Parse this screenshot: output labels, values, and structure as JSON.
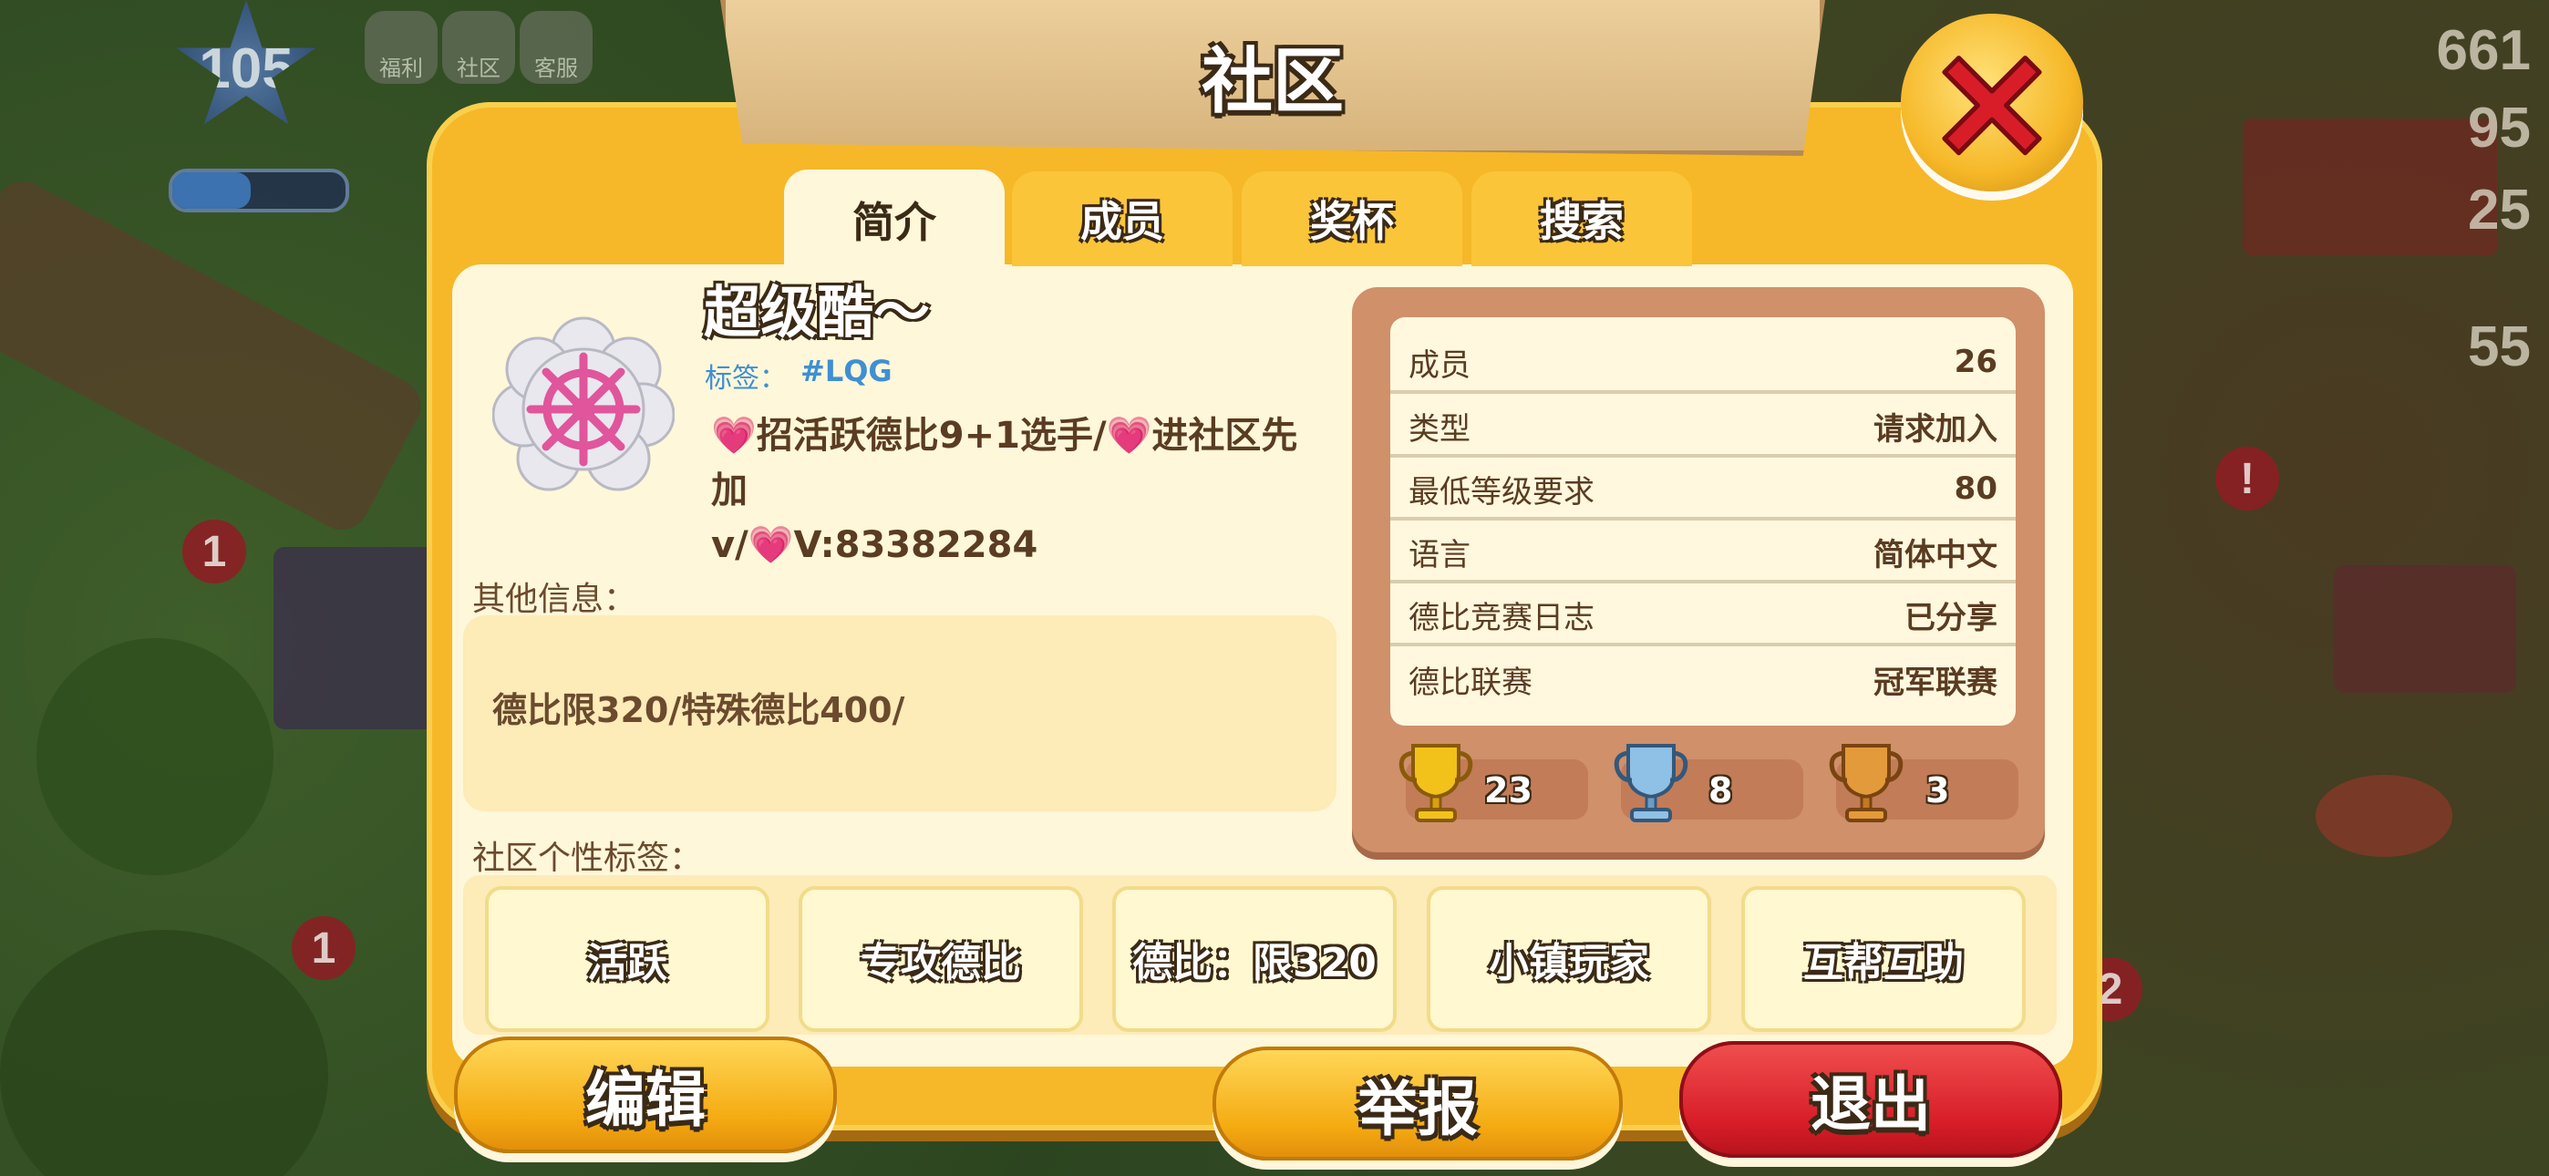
{
  "hud": {
    "level": "105",
    "icons": [
      "福利",
      "社区",
      "客服"
    ],
    "right_numbers": [
      "661",
      "95",
      "25",
      "55"
    ],
    "side_badges": [
      "1",
      "1",
      "!",
      "2"
    ]
  },
  "dialog": {
    "title": "社区",
    "tabs": [
      "简介",
      "成员",
      "奖杯",
      "搜索"
    ],
    "active_tab": "简介"
  },
  "club": {
    "name": "超级酷～",
    "tag_label": "标签：",
    "tag_value": "#LQG",
    "description_line1": "💗招活跃德比9+1选手/💗进社区先加",
    "description_line2": "v/💗V:83382284",
    "other_info_label": "其他信息：",
    "other_info_text": "德比限320/特殊德比400/",
    "personal_tags_label": "社区个性标签：",
    "personal_tags": [
      "活跃",
      "专攻德比",
      "德比：限320",
      "小镇玩家",
      "互帮互助"
    ]
  },
  "stats": [
    {
      "key": "成员",
      "value": "26"
    },
    {
      "key": "类型",
      "value": "请求加入"
    },
    {
      "key": "最低等级要求",
      "value": "80"
    },
    {
      "key": "语言",
      "value": "简体中文"
    },
    {
      "key": "德比竞赛日志",
      "value": "已分享"
    },
    {
      "key": "德比联赛",
      "value": "冠军联赛"
    }
  ],
  "trophies": [
    {
      "icon": "gold-trophy-icon",
      "count": "23",
      "color": "#f2c21b"
    },
    {
      "icon": "silver-trophy-icon",
      "count": "8",
      "color": "#8fc0e6"
    },
    {
      "icon": "bronze-trophy-icon",
      "count": "3",
      "color": "#e39a3a"
    }
  ],
  "buttons": {
    "edit": "编辑",
    "report": "举报",
    "leave": "退出"
  },
  "colors": {
    "panel": "#f6b828",
    "panel_inner": "#fff7d9",
    "close": "#d81d28",
    "leave_button": "#d81d28",
    "tag_link": "#3f8fd4"
  }
}
